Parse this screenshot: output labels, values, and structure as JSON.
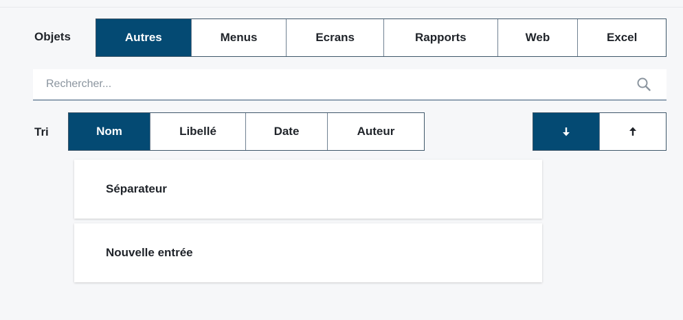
{
  "objects": {
    "label": "Objets",
    "tabs": [
      {
        "label": "Autres",
        "active": true
      },
      {
        "label": "Menus",
        "active": false
      },
      {
        "label": "Ecrans",
        "active": false
      },
      {
        "label": "Rapports",
        "active": false
      },
      {
        "label": "Web",
        "active": false
      },
      {
        "label": "Excel",
        "active": false
      }
    ]
  },
  "search": {
    "placeholder": "Rechercher...",
    "value": "",
    "icon": "search-icon"
  },
  "sort": {
    "label": "Tri",
    "tabs": [
      {
        "label": "Nom",
        "active": true
      },
      {
        "label": "Libellé",
        "active": false
      },
      {
        "label": "Date",
        "active": false
      },
      {
        "label": "Auteur",
        "active": false
      }
    ],
    "order": [
      {
        "icon": "arrow-down-icon",
        "active": true
      },
      {
        "icon": "arrow-up-icon",
        "active": false
      }
    ]
  },
  "items": [
    {
      "label": "Séparateur"
    },
    {
      "label": "Nouvelle entrée"
    }
  ],
  "colors": {
    "accent": "#044a73",
    "background": "#f6f7f9"
  }
}
